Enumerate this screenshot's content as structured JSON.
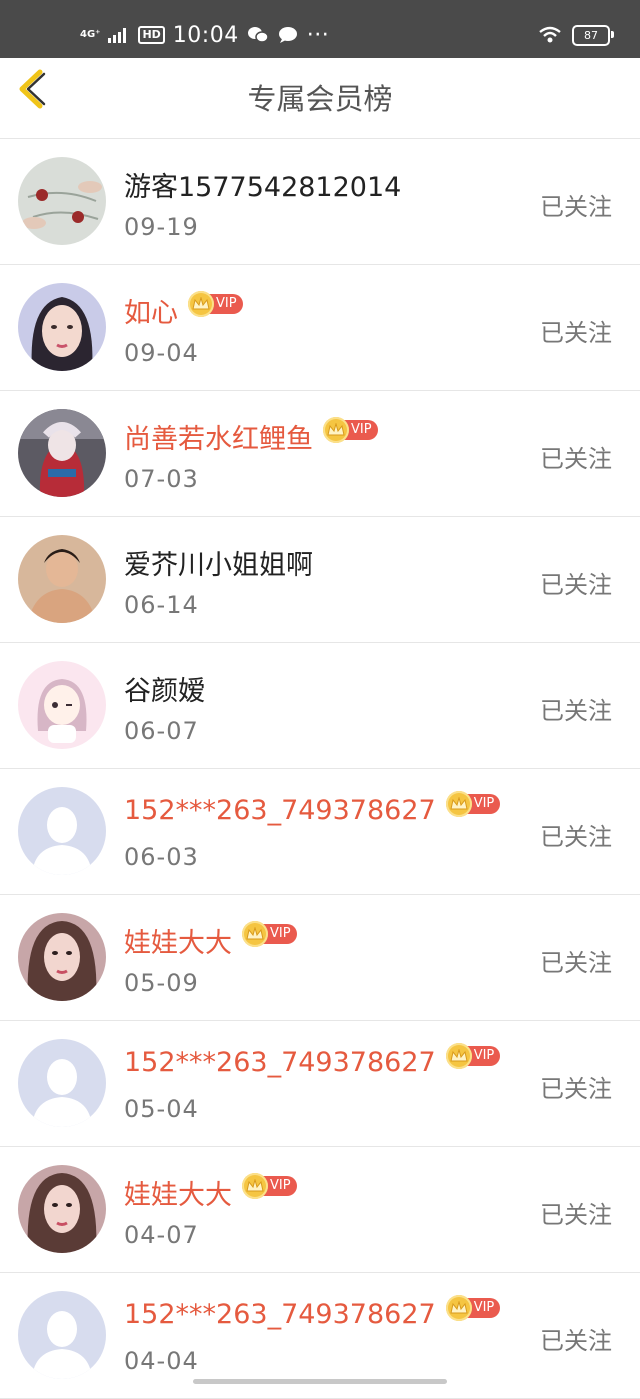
{
  "status_bar": {
    "network": "4G⁺",
    "hd": "HD",
    "time": "10:04",
    "more": "···",
    "battery": "87"
  },
  "header": {
    "title": "专属会员榜",
    "back_icon": "chevron-left-icon"
  },
  "vip_label": "VIP",
  "colors": {
    "vip_name": "#e55a3f",
    "normal_name": "#222222",
    "back_arrow": "#f0c419",
    "vip_badge": "#ea5a4e"
  },
  "members": [
    {
      "name": "游客1577542812014",
      "date": "09-19",
      "status": "已关注",
      "vip": false,
      "avatar": "roses"
    },
    {
      "name": "如心",
      "date": "09-04",
      "status": "已关注",
      "vip": true,
      "avatar": "portrait-woman"
    },
    {
      "name": "尚善若水红鲤鱼",
      "date": "07-03",
      "status": "已关注",
      "vip": true,
      "avatar": "harley"
    },
    {
      "name": "爱芥川小姐姐啊",
      "date": "06-14",
      "status": "已关注",
      "vip": false,
      "avatar": "man"
    },
    {
      "name": "谷颜嫒",
      "date": "06-07",
      "status": "已关注",
      "vip": false,
      "avatar": "cartoon-girl"
    },
    {
      "name": "152***263_749378627",
      "date": "06-03",
      "status": "已关注",
      "vip": true,
      "avatar": "default"
    },
    {
      "name": "娃娃大大",
      "date": "05-09",
      "status": "已关注",
      "vip": true,
      "avatar": "girl-selfie"
    },
    {
      "name": "152***263_749378627",
      "date": "05-04",
      "status": "已关注",
      "vip": true,
      "avatar": "default"
    },
    {
      "name": "娃娃大大",
      "date": "04-07",
      "status": "已关注",
      "vip": true,
      "avatar": "girl-selfie"
    },
    {
      "name": "152***263_749378627",
      "date": "04-04",
      "status": "已关注",
      "vip": true,
      "avatar": "default"
    }
  ]
}
